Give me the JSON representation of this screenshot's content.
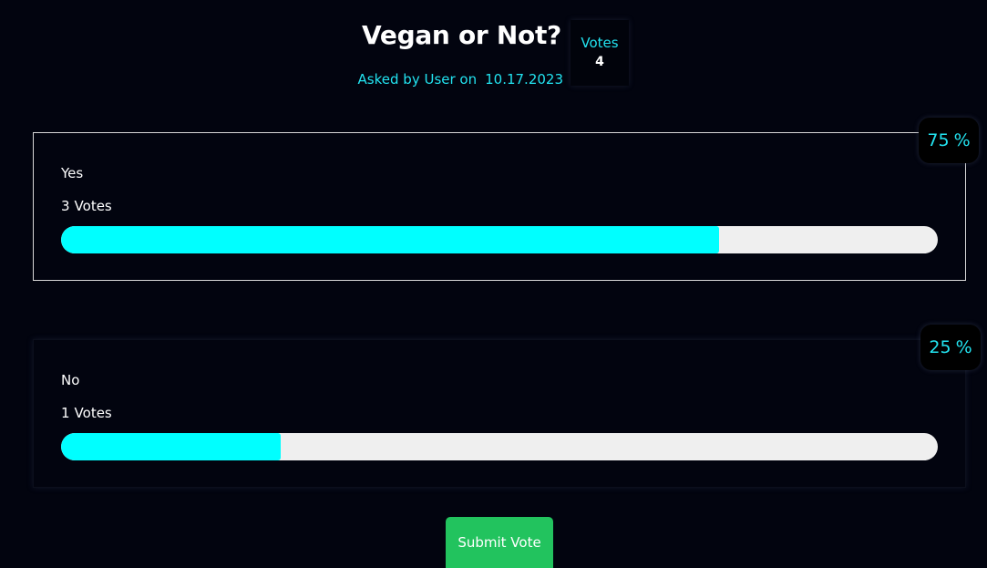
{
  "poll": {
    "title": "Vegan or Not?",
    "asked_by_label": "Asked by User on",
    "date": "10.17.2023",
    "votes_label": "Votes",
    "total_votes": "4"
  },
  "options": [
    {
      "label": "Yes",
      "votes": "3",
      "votes_suffix": "Votes",
      "percent": 75,
      "percent_text": "75",
      "unit": "%",
      "selected": true
    },
    {
      "label": "No",
      "votes": "1",
      "votes_suffix": "Votes",
      "percent": 25,
      "percent_text": "25",
      "unit": "%",
      "selected": false
    }
  ],
  "actions": {
    "submit_label": "Submit Vote"
  },
  "colors": {
    "background": "#02040f",
    "accent_text": "#22e3f0",
    "bar_fill": "#00ffff",
    "bar_track": "#efefef",
    "submit_button": "#22c35e"
  }
}
